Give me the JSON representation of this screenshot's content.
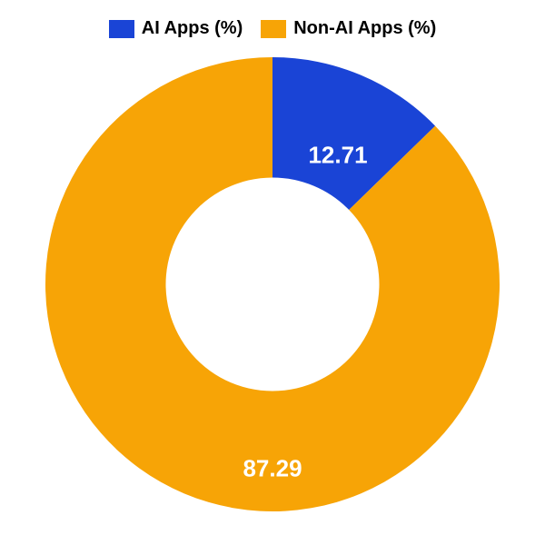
{
  "legend": {
    "ai": "AI Apps (%)",
    "non_ai": "Non-AI Apps (%)"
  },
  "chart_data": {
    "type": "pie",
    "series": [
      {
        "name": "AI Apps (%)",
        "value": 12.71,
        "color": "#1a44d6"
      },
      {
        "name": "Non-AI Apps (%)",
        "value": 87.29,
        "color": "#f7a406"
      }
    ],
    "labels": {
      "ai": "12.71",
      "non_ai": "87.29"
    },
    "donut_inner_ratio": 0.47
  }
}
